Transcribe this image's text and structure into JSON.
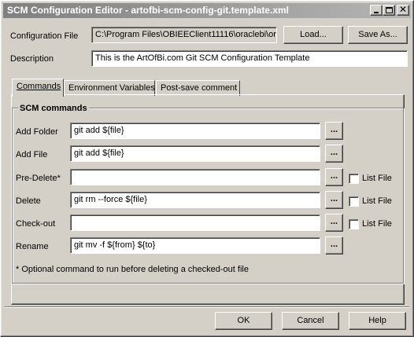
{
  "window": {
    "title": "SCM Configuration Editor - artofbi-scm-config-git.template.xml"
  },
  "config_file": {
    "label": "Configuration File",
    "value": "C:\\Program Files\\OBIEEClient11116\\oraclebi\\or",
    "load_label": "Load...",
    "save_as_label": "Save As..."
  },
  "description": {
    "label": "Description",
    "value": "This is the ArtOfBi.com Git SCM Configuration Template"
  },
  "tabs": [
    {
      "label": "Commands",
      "active": true
    },
    {
      "label": "Environment Variables",
      "active": false
    },
    {
      "label": "Post-save comment",
      "active": false
    }
  ],
  "scm": {
    "group_title": "SCM commands",
    "browse_label": "...",
    "list_file_label": "List File",
    "rows": [
      {
        "label": "Add Folder",
        "value": "git add ${file}"
      },
      {
        "label": "Add File",
        "value": "git add ${file}"
      },
      {
        "label": "Pre-Delete*",
        "value": ""
      },
      {
        "label": "Delete",
        "value": "git rm --force ${file}"
      },
      {
        "label": "Check-out",
        "value": ""
      },
      {
        "label": "Rename",
        "value": "git mv -f ${from} ${to}"
      }
    ],
    "footnote": "* Optional command to run before deleting a checked-out file"
  },
  "footer": {
    "ok_label": "OK",
    "cancel_label": "Cancel",
    "help_label": "Help"
  }
}
